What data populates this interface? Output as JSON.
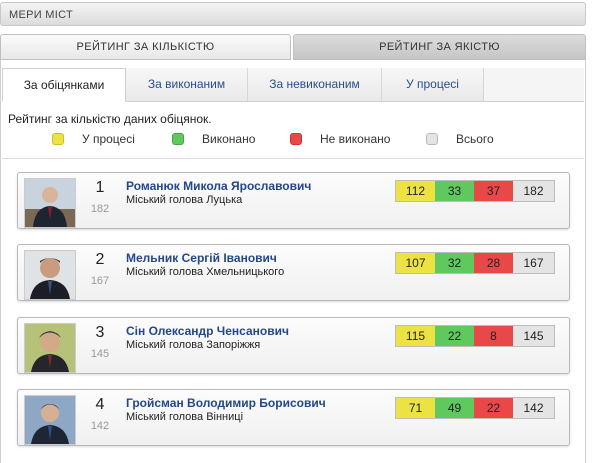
{
  "header": {
    "title": "МЕРИ МІСТ"
  },
  "main_tabs": [
    {
      "label": "РЕЙТИНГ ЗА КІЛЬКІСТЮ",
      "active": true
    },
    {
      "label": "РЕЙТИНГ ЗА ЯКІСТЮ",
      "active": false
    }
  ],
  "sub_tabs": [
    {
      "label": "За обіцянками",
      "active": true
    },
    {
      "label": "За виконаним",
      "active": false
    },
    {
      "label": "За невиконаним",
      "active": false
    },
    {
      "label": "У процесі",
      "active": false
    }
  ],
  "description": "Рейтинг за кількістю даних обіцянок.",
  "legend": [
    {
      "label": "У процесі",
      "color": "#ece243"
    },
    {
      "label": "Виконано",
      "color": "#5fc85f"
    },
    {
      "label": "Не виконано",
      "color": "#e84848"
    },
    {
      "label": "Всього",
      "color": "#e4e4e4"
    }
  ],
  "mayors": [
    {
      "rank": "1",
      "total_small": "182",
      "name": "Романюк Микола Ярославович",
      "role": "Міський голова Луцька",
      "in_progress": "112",
      "done": "33",
      "not_done": "37",
      "total": "182"
    },
    {
      "rank": "2",
      "total_small": "167",
      "name": "Мельник Сергій Іванович",
      "role": "Міський голова Хмельницького",
      "in_progress": "107",
      "done": "32",
      "not_done": "28",
      "total": "167"
    },
    {
      "rank": "3",
      "total_small": "145",
      "name": "Сін Олександр Ченсанович",
      "role": "Міський голова Запоріжжя",
      "in_progress": "115",
      "done": "22",
      "not_done": "8",
      "total": "145"
    },
    {
      "rank": "4",
      "total_small": "142",
      "name": "Гройсман Володимир Борисович",
      "role": "Міський голова Вінниці",
      "in_progress": "71",
      "done": "49",
      "not_done": "22",
      "total": "142"
    }
  ]
}
